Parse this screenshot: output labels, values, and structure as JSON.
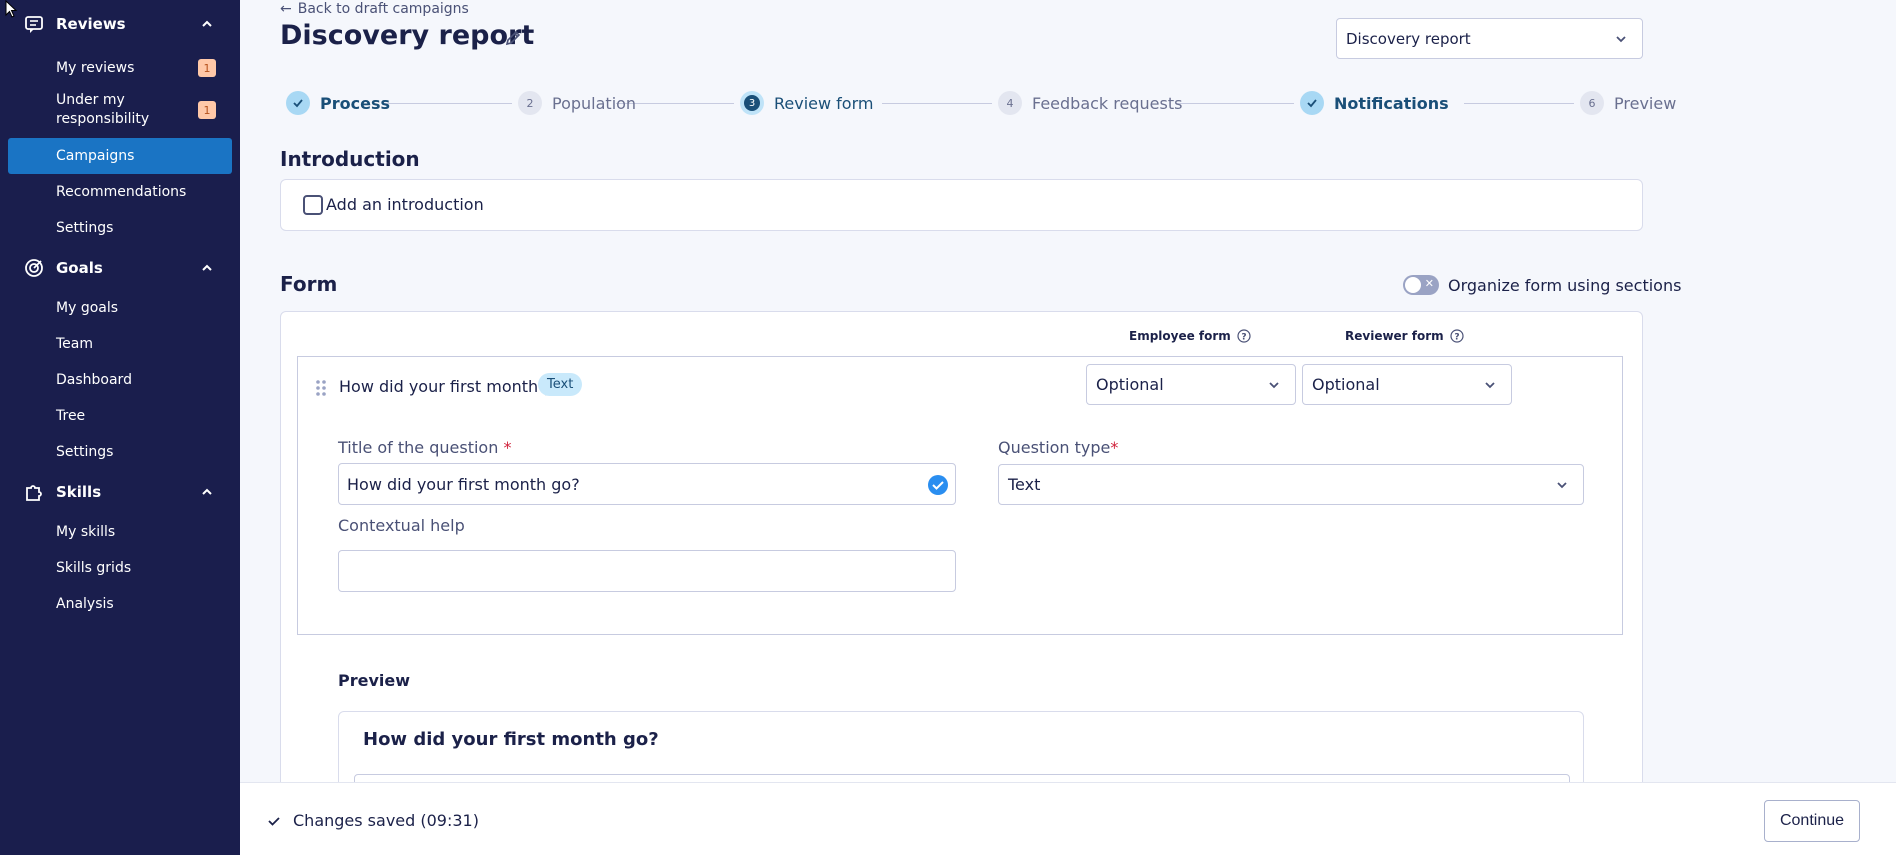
{
  "sidebar": {
    "sections": [
      {
        "label": "Reviews",
        "icon": "reviews-icon",
        "items": [
          {
            "label": "My reviews",
            "badge": "1"
          },
          {
            "label": "Under my responsibility",
            "badge": "1"
          },
          {
            "label": "Campaigns",
            "active": true
          },
          {
            "label": "Recommendations"
          },
          {
            "label": "Settings"
          }
        ]
      },
      {
        "label": "Goals",
        "icon": "target-icon",
        "items": [
          {
            "label": "My goals"
          },
          {
            "label": "Team"
          },
          {
            "label": "Dashboard"
          },
          {
            "label": "Tree"
          },
          {
            "label": "Settings"
          }
        ]
      },
      {
        "label": "Skills",
        "icon": "puzzle-icon",
        "items": [
          {
            "label": "My skills"
          },
          {
            "label": "Skills grids"
          },
          {
            "label": "Analysis"
          }
        ]
      }
    ]
  },
  "header": {
    "back_label": "Back to draft campaigns",
    "title": "Discovery report",
    "report_select": "Discovery report"
  },
  "steps": [
    {
      "num": "✓",
      "label": "Process",
      "state": "done"
    },
    {
      "num": "2",
      "label": "Population",
      "state": "todo"
    },
    {
      "num": "3",
      "label": "Review form",
      "state": "current"
    },
    {
      "num": "4",
      "label": "Feedback requests",
      "state": "todo"
    },
    {
      "num": "✓",
      "label": "Notifications",
      "state": "done"
    },
    {
      "num": "6",
      "label": "Preview",
      "state": "todo"
    }
  ],
  "introduction": {
    "heading": "Introduction",
    "checkbox_label": "Add an introduction",
    "checked": false
  },
  "form": {
    "heading": "Form",
    "toggle_label": "Organize form using sections",
    "toggle_on": false,
    "employee_form_header": "Employee form",
    "reviewer_form_header": "Reviewer form",
    "question": {
      "title": "How did your first month go?",
      "tag": "Text",
      "employee_value": "Optional",
      "reviewer_value": "Optional",
      "title_label": "Title of the question",
      "required_mark": "*",
      "title_value": "How did your first month go?",
      "type_label": "Question type",
      "type_value": "Text",
      "help_label": "Contextual help",
      "help_value": ""
    },
    "preview_label": "Preview",
    "preview_question": "How did your first month go?"
  },
  "footer": {
    "saved_text": "Changes saved (09:31)",
    "continue_label": "Continue"
  },
  "colors": {
    "sidebar_bg": "#1a1e4d",
    "active_nav": "#1a74c4",
    "badge_bg": "#ffc8a8",
    "accent": "#1a4f78",
    "check_blue": "#2a8ef0"
  }
}
